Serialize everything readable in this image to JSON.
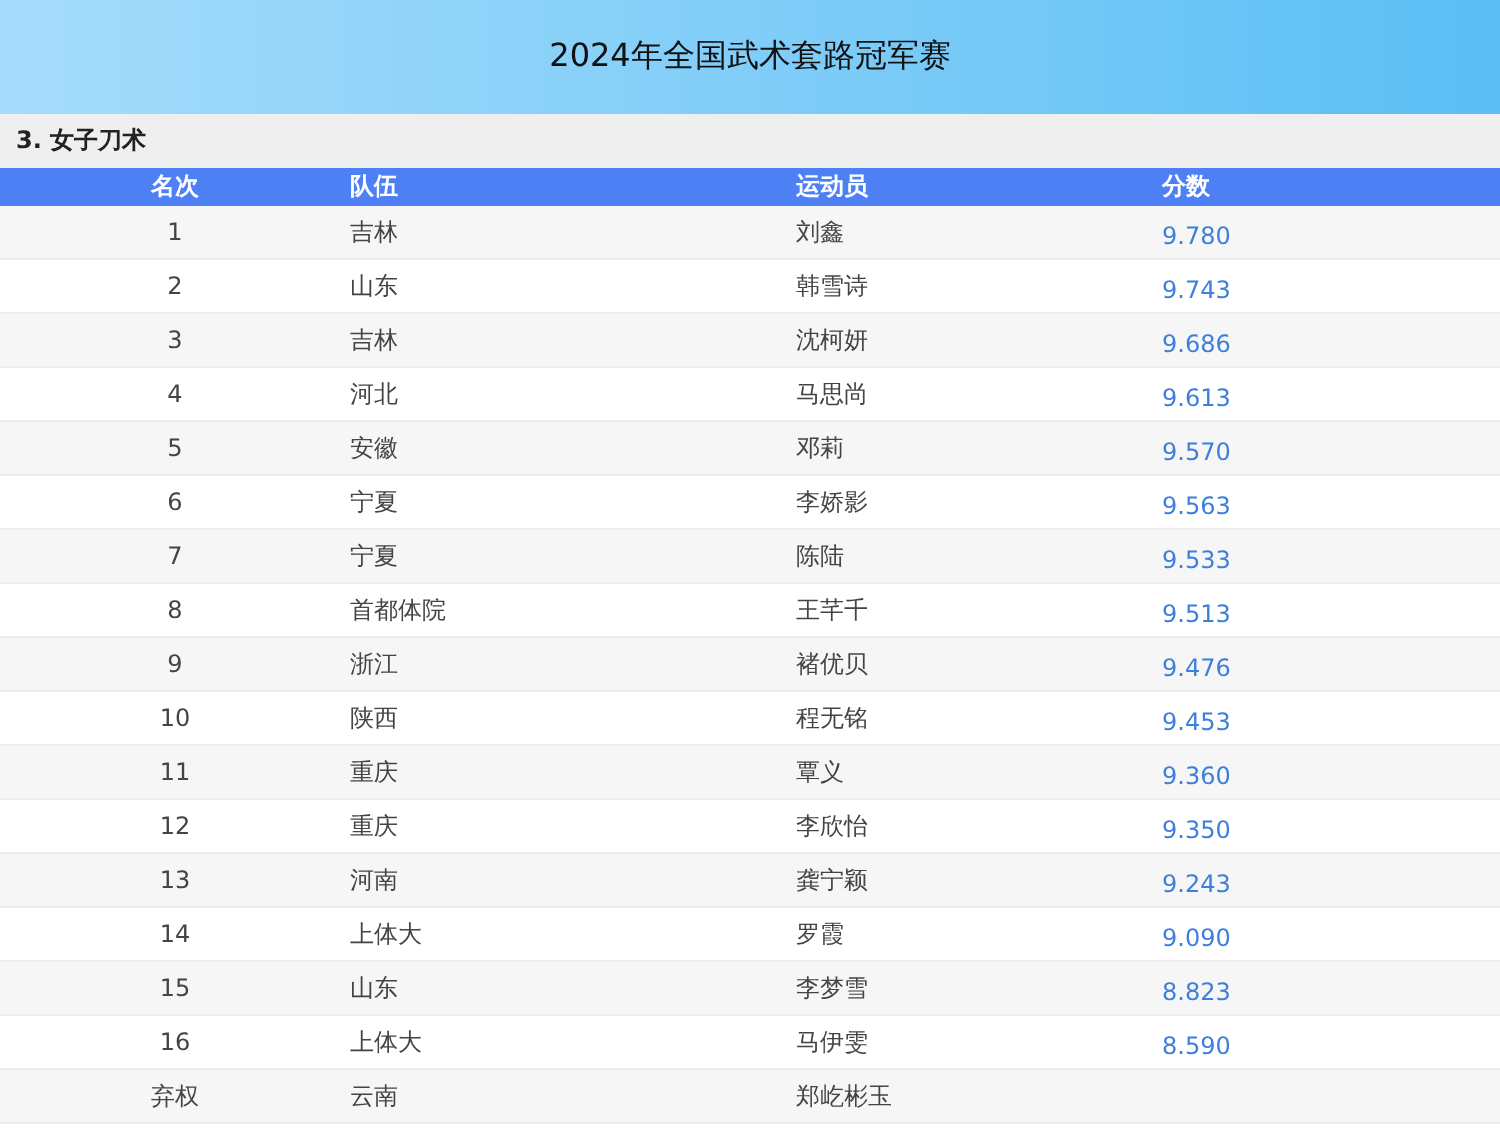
{
  "title": "2024年全国武术套路冠军赛",
  "section": "3. 女子刀术",
  "table": {
    "columns": [
      "名次",
      "队伍",
      "运动员",
      "分数"
    ],
    "rows": [
      {
        "rank": "1",
        "team": "吉林",
        "athlete": "刘鑫",
        "score": "9.780"
      },
      {
        "rank": "2",
        "team": "山东",
        "athlete": "韩雪诗",
        "score": "9.743"
      },
      {
        "rank": "3",
        "team": "吉林",
        "athlete": "沈柯妍",
        "score": "9.686"
      },
      {
        "rank": "4",
        "team": "河北",
        "athlete": "马思尚",
        "score": "9.613"
      },
      {
        "rank": "5",
        "team": "安徽",
        "athlete": "邓莉",
        "score": "9.570"
      },
      {
        "rank": "6",
        "team": "宁夏",
        "athlete": "李娇影",
        "score": "9.563"
      },
      {
        "rank": "7",
        "team": "宁夏",
        "athlete": "陈陆",
        "score": "9.533"
      },
      {
        "rank": "8",
        "team": "首都体院",
        "athlete": "王芊千",
        "score": "9.513"
      },
      {
        "rank": "9",
        "team": "浙江",
        "athlete": "褚优贝",
        "score": "9.476"
      },
      {
        "rank": "10",
        "team": "陕西",
        "athlete": "程无铭",
        "score": "9.453"
      },
      {
        "rank": "11",
        "team": "重庆",
        "athlete": "覃义",
        "score": "9.360"
      },
      {
        "rank": "12",
        "team": "重庆",
        "athlete": "李欣怡",
        "score": "9.350"
      },
      {
        "rank": "13",
        "team": "河南",
        "athlete": "龚宁颖",
        "score": "9.243"
      },
      {
        "rank": "14",
        "team": "上体大",
        "athlete": "罗霞",
        "score": "9.090"
      },
      {
        "rank": "15",
        "team": "山东",
        "athlete": "李梦雪",
        "score": "8.823"
      },
      {
        "rank": "16",
        "team": "上体大",
        "athlete": "马伊雯",
        "score": "8.590"
      },
      {
        "rank": "弃权",
        "team": "云南",
        "athlete": "郑屹彬玉"
      }
    ]
  }
}
